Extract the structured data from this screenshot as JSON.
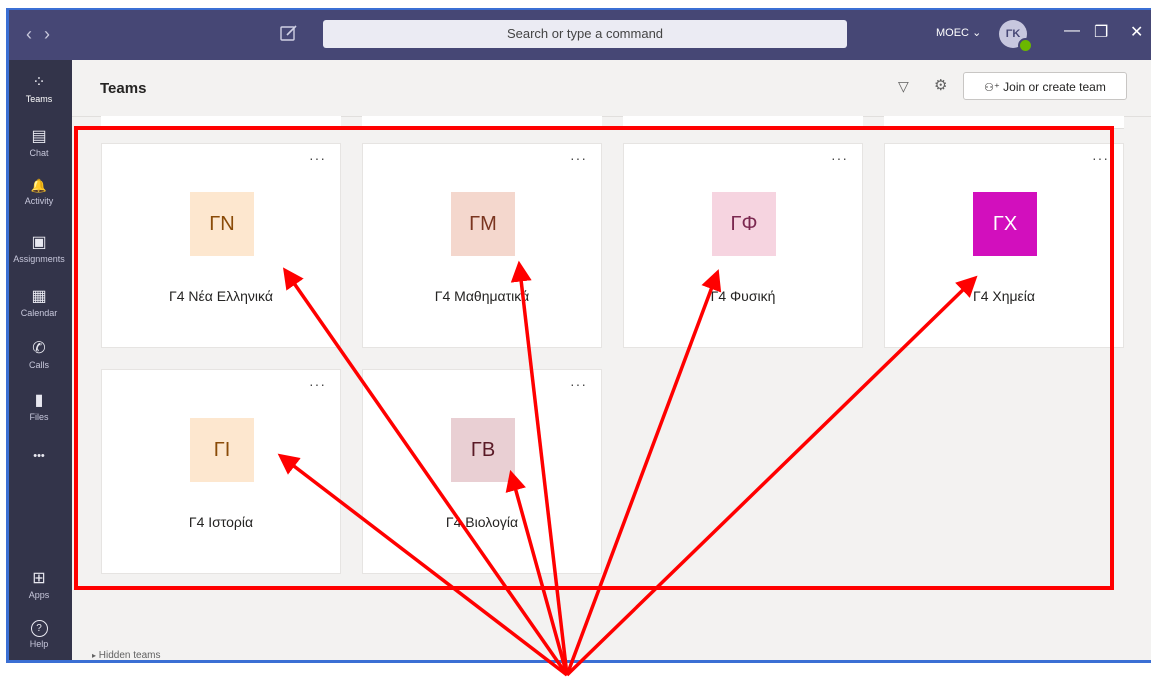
{
  "titlebar": {
    "nav_back": "‹",
    "nav_forward": "›",
    "search_placeholder": "Search or type a command",
    "org": "MOEC",
    "avatar_initials": "ΓΚ"
  },
  "rail": {
    "items": [
      {
        "label": "Teams",
        "icon": "teams-icon",
        "glyph": "⁘"
      },
      {
        "label": "Chat",
        "icon": "chat-icon",
        "glyph": "▤"
      },
      {
        "label": "Activity",
        "icon": "bell-icon",
        "glyph": "🔔"
      },
      {
        "label": "Assignments",
        "icon": "assignments-icon",
        "glyph": "▣"
      },
      {
        "label": "Calendar",
        "icon": "calendar-icon",
        "glyph": "▦"
      },
      {
        "label": "Calls",
        "icon": "phone-icon",
        "glyph": "✆"
      },
      {
        "label": "Files",
        "icon": "file-icon",
        "glyph": "▮"
      },
      {
        "label": "",
        "icon": "more-icon",
        "glyph": "•••"
      },
      {
        "label": "Apps",
        "icon": "apps-icon",
        "glyph": "⊞"
      },
      {
        "label": "Help",
        "icon": "help-icon",
        "glyph": "?"
      }
    ]
  },
  "header": {
    "title": "Teams",
    "join_label": "Join or create team"
  },
  "teams": [
    {
      "name": "Γ4 Νέα Ελληνικά",
      "initials": "ΓΝ",
      "bg": "#fde7cf",
      "fg": "#8a4b08"
    },
    {
      "name": "Γ4 Μαθηματικά",
      "initials": "ΓΜ",
      "bg": "#f4d7cd",
      "fg": "#7a3520"
    },
    {
      "name": "Γ4 Φυσική",
      "initials": "ΓΦ",
      "bg": "#f6d4e0",
      "fg": "#7b2850"
    },
    {
      "name": "Γ4 Χημεία",
      "initials": "ΓΧ",
      "bg": "#d20fbd",
      "fg": "#ffffff"
    },
    {
      "name": "Γ4 Ιστορία",
      "initials": "ΓΙ",
      "bg": "#fde7cf",
      "fg": "#8a4b08"
    },
    {
      "name": "Γ4 Βιολογία",
      "initials": "ΓΒ",
      "bg": "#e9cfd3",
      "fg": "#5a1a26"
    }
  ],
  "footer": {
    "hidden_teams": "Hidden teams"
  },
  "annotation": {
    "highlight_color": "#ff0000"
  }
}
